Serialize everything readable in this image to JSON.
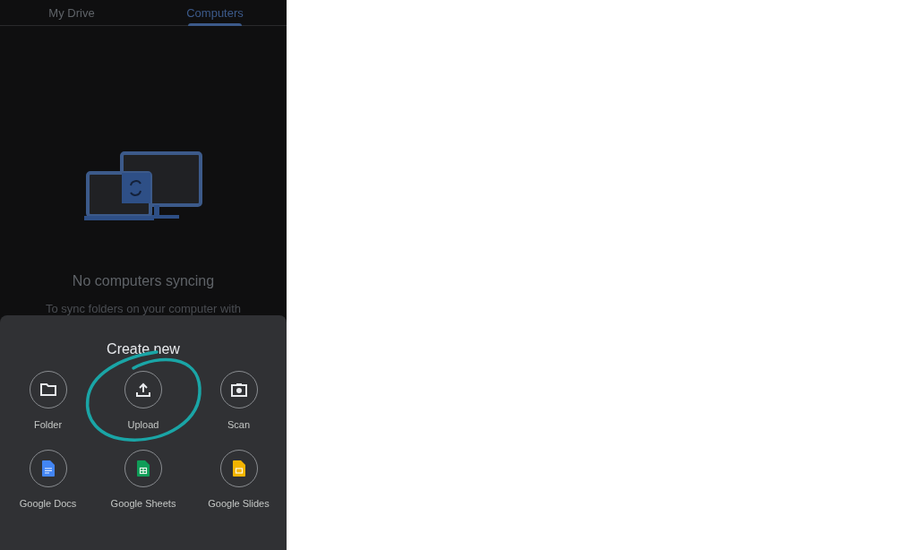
{
  "tabs": [
    {
      "label": "My Drive",
      "selected": false
    },
    {
      "label": "Computers",
      "selected": true
    }
  ],
  "empty_state": {
    "title": "No computers syncing",
    "text": "To sync folders on your computer with"
  },
  "sheet": {
    "title": "Create new",
    "items": [
      {
        "kind": "folder",
        "label": "Folder",
        "circled": false
      },
      {
        "kind": "upload",
        "label": "Upload",
        "circled": true
      },
      {
        "kind": "scan",
        "label": "Scan",
        "circled": false
      },
      {
        "kind": "docs",
        "label": "Google Docs",
        "circled": false
      },
      {
        "kind": "sheets",
        "label": "Google Sheets",
        "circled": false
      },
      {
        "kind": "slides",
        "label": "Google Slides",
        "circled": false
      }
    ]
  }
}
